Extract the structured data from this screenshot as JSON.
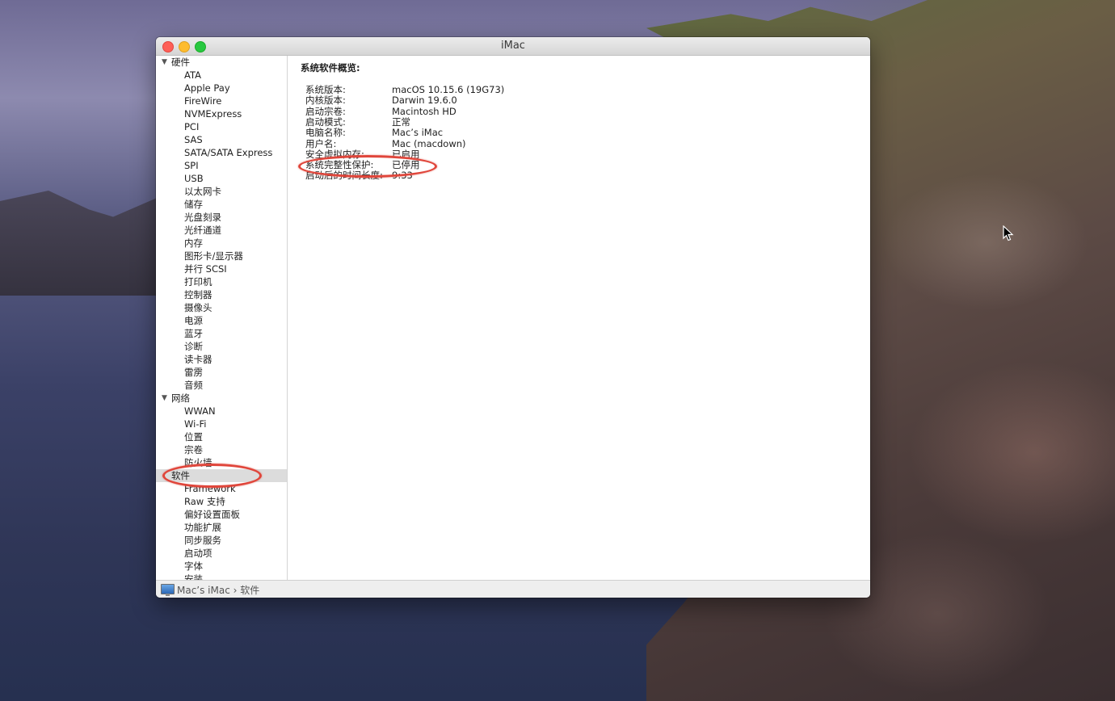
{
  "window": {
    "title": "iMac"
  },
  "sidebar": {
    "categories": [
      {
        "label": "硬件",
        "items": [
          "ATA",
          "Apple Pay",
          "FireWire",
          "NVMExpress",
          "PCI",
          "SAS",
          "SATA/SATA Express",
          "SPI",
          "USB",
          "以太网卡",
          "储存",
          "光盘刻录",
          "光纤通道",
          "内存",
          "图形卡/显示器",
          "并行 SCSI",
          "打印机",
          "控制器",
          "摄像头",
          "电源",
          "蓝牙",
          "诊断",
          "读卡器",
          "雷雳",
          "音频"
        ]
      },
      {
        "label": "网络",
        "items": [
          "WWAN",
          "Wi-Fi",
          "位置",
          "宗卷",
          "防火墙"
        ]
      },
      {
        "label": "软件",
        "selected": true,
        "items": [
          "Framework",
          "Raw 支持",
          "偏好设置面板",
          "功能扩展",
          "同步服务",
          "启动项",
          "字体",
          "安装"
        ]
      }
    ]
  },
  "content": {
    "heading": "系统软件概览:",
    "rows": [
      {
        "key": "系统版本:",
        "value": "macOS 10.15.6 (19G73)"
      },
      {
        "key": "内核版本:",
        "value": "Darwin 19.6.0"
      },
      {
        "key": "启动宗卷:",
        "value": "Macintosh HD"
      },
      {
        "key": "启动模式:",
        "value": "正常"
      },
      {
        "key": "电脑名称:",
        "value": "Mac’s iMac"
      },
      {
        "key": "用户名:",
        "value": "Mac (macdown)"
      },
      {
        "key": "安全虚拟内存:",
        "value": "已启用"
      },
      {
        "key": "系统完整性保护:",
        "value": "已停用"
      },
      {
        "key": "启动后的时间长度:",
        "value": "9:33"
      }
    ]
  },
  "statusbar": {
    "path": "Mac’s iMac › 软件"
  },
  "icons": {
    "computer": "computer-icon",
    "disclosure": "disclosure-triangle-icon",
    "cursor": "mouse-pointer-icon"
  },
  "colors": {
    "annotation": "#e0463b",
    "selection": "#dcdcdc"
  }
}
